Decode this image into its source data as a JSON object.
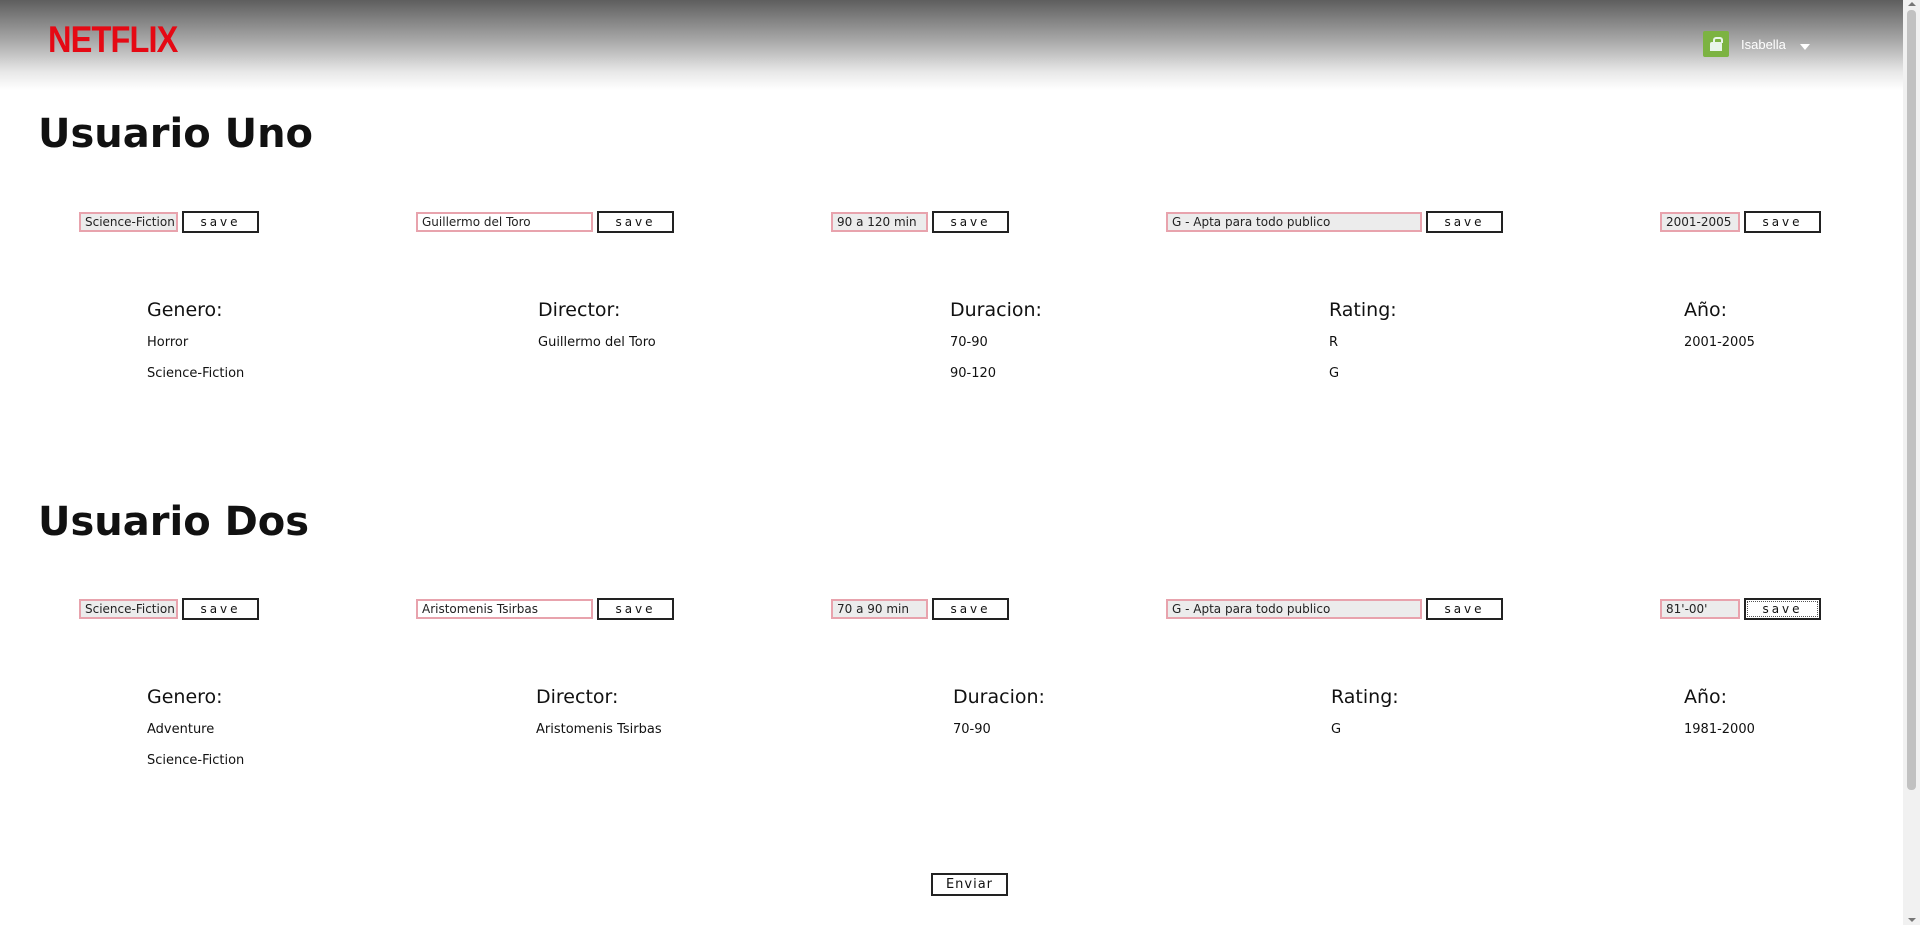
{
  "header": {
    "logo": "NETFLIX",
    "username": "Isabella"
  },
  "users": [
    {
      "title": "Usuario Uno",
      "inputs": {
        "genero": "Science-Fiction",
        "director": "Guillermo del Toro",
        "duracion": "90 a 120 min",
        "rating": "G - Apta para todo publico",
        "anio": "2001-2005"
      },
      "columns": {
        "genero": {
          "heading": "Genero:",
          "items": [
            "Horror",
            "Science-Fiction"
          ]
        },
        "director": {
          "heading": "Director:",
          "items": [
            "Guillermo del Toro"
          ]
        },
        "duracion": {
          "heading": "Duracion:",
          "items": [
            "70-90",
            "90-120"
          ]
        },
        "rating": {
          "heading": "Rating:",
          "items": [
            "R",
            "G"
          ]
        },
        "anio": {
          "heading": "Año:",
          "items": [
            "2001-2005"
          ]
        }
      }
    },
    {
      "title": "Usuario Dos",
      "inputs": {
        "genero": "Science-Fiction",
        "director": "Aristomenis Tsirbas",
        "duracion": "70 a 90 min",
        "rating": "G - Apta para todo publico",
        "anio": "81'-00'"
      },
      "columns": {
        "genero": {
          "heading": "Genero:",
          "items": [
            "Adventure",
            "Science-Fiction"
          ]
        },
        "director": {
          "heading": "Director:",
          "items": [
            "Aristomenis Tsirbas"
          ]
        },
        "duracion": {
          "heading": "Duracion:",
          "items": [
            "70-90"
          ]
        },
        "rating": {
          "heading": "Rating:",
          "items": [
            "G"
          ]
        },
        "anio": {
          "heading": "Año:",
          "items": [
            "1981-2000"
          ]
        }
      }
    }
  ],
  "buttons": {
    "save": "save",
    "enviar": "Enviar"
  },
  "colors": {
    "brand": "#e50914",
    "field_border": "#e8a3ad",
    "avatar": "#7cb342"
  }
}
